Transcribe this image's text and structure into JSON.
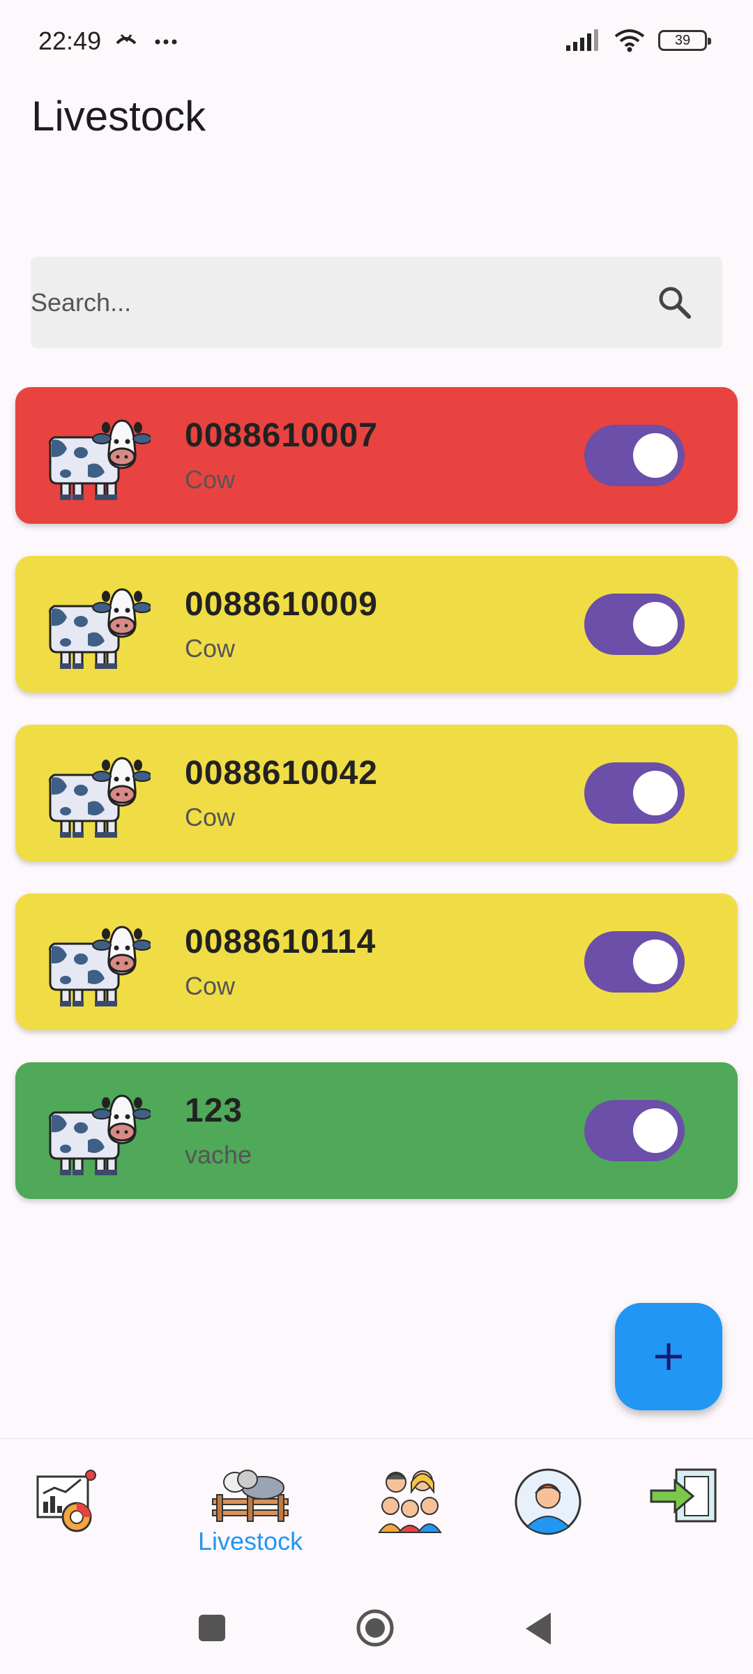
{
  "status_bar": {
    "time": "22:49",
    "battery": "39"
  },
  "page": {
    "title": "Livestock"
  },
  "search": {
    "placeholder": "Search..."
  },
  "animals": [
    {
      "tag": "0088610007",
      "species": "Cow",
      "color": "#e84340",
      "enabled": true
    },
    {
      "tag": "0088610009",
      "species": "Cow",
      "color": "#f0dd45",
      "enabled": true
    },
    {
      "tag": "0088610042",
      "species": "Cow",
      "color": "#f0dd45",
      "enabled": true
    },
    {
      "tag": "0088610114",
      "species": "Cow",
      "color": "#f0dd45",
      "enabled": true
    },
    {
      "tag": "123",
      "species": " vache",
      "color": "#4fa958",
      "enabled": true
    }
  ],
  "bottom_nav": {
    "active_label": "Livestock",
    "items": [
      {
        "icon": "dashboard-chart-icon"
      },
      {
        "icon": "livestock-icon",
        "label": "Livestock"
      },
      {
        "icon": "people-group-icon"
      },
      {
        "icon": "profile-avatar-icon"
      },
      {
        "icon": "logout-icon"
      }
    ]
  },
  "colors": {
    "accent": "#2196f3",
    "toggle": "#6b4fa8",
    "red_card": "#e84340",
    "yellow_card": "#f0dd45",
    "green_card": "#4fa958"
  }
}
